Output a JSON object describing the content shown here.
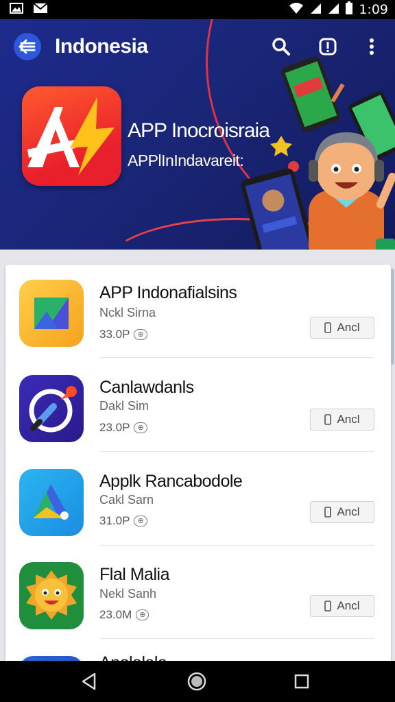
{
  "status_bar": {
    "time": "1:09"
  },
  "header": {
    "title": "Indonesia"
  },
  "hero": {
    "line1": "APP Inocroisraia",
    "line2": "APPlInIndavareit:"
  },
  "apps": [
    {
      "name": "APP Indonafialsins",
      "subtitle": "Nckl Sirna",
      "size": "33.0P",
      "button": "Ancl"
    },
    {
      "name": "Canlawdanls",
      "subtitle": "Dakl Sim",
      "size": "23.0P",
      "button": "Ancl"
    },
    {
      "name": "Applk Rancabodole",
      "subtitle": "Cakl Sarn",
      "size": "31.0P",
      "button": "Ancl"
    },
    {
      "name": "Flal Malia",
      "subtitle": "Nekl Sanh",
      "size": "23.0M",
      "button": "Ancl"
    }
  ],
  "partial_app_name": "Anolalala",
  "colors": {
    "hero_bg": "#1a2677",
    "accent_blue": "#2c57d9",
    "logo_red": "#e8202c"
  },
  "icons": {
    "back": "arrow-back-icon",
    "search": "search-icon",
    "alert": "alert-icon",
    "more": "more-vert-icon",
    "install": "phone-icon"
  }
}
